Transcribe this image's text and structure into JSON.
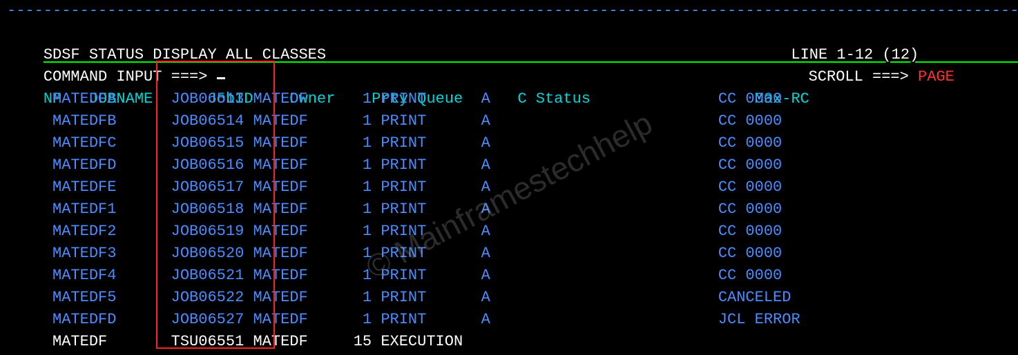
{
  "divider_line": "-----------------------------------------------------------------------------------------------------------------------",
  "header": {
    "title_left": "SDSF STATUS DISPLAY ALL CLASSES",
    "title_right": "LINE 1-12 (12)",
    "cmd_label": "COMMAND INPUT ===>",
    "scroll_label": "SCROLL ===>",
    "scroll_value": "PAGE"
  },
  "columns": {
    "np": "NP",
    "jobname": "JOBNAME",
    "jobid": "JobID",
    "owner": "Owner",
    "prty": "Prty",
    "queue": "Queue",
    "c": "C",
    "status": "Status",
    "maxrc": "Max-RC"
  },
  "rows": [
    {
      "np": "",
      "jobname": "MATEDFA",
      "jobid": "JOB06513",
      "owner": "MATEDF",
      "prty": "1",
      "queue": "PRINT",
      "c": "A",
      "status": "",
      "maxrc": "CC 0000",
      "color": "blue"
    },
    {
      "np": "",
      "jobname": "MATEDFB",
      "jobid": "JOB06514",
      "owner": "MATEDF",
      "prty": "1",
      "queue": "PRINT",
      "c": "A",
      "status": "",
      "maxrc": "CC 0000",
      "color": "blue"
    },
    {
      "np": "",
      "jobname": "MATEDFC",
      "jobid": "JOB06515",
      "owner": "MATEDF",
      "prty": "1",
      "queue": "PRINT",
      "c": "A",
      "status": "",
      "maxrc": "CC 0000",
      "color": "blue"
    },
    {
      "np": "",
      "jobname": "MATEDFD",
      "jobid": "JOB06516",
      "owner": "MATEDF",
      "prty": "1",
      "queue": "PRINT",
      "c": "A",
      "status": "",
      "maxrc": "CC 0000",
      "color": "blue"
    },
    {
      "np": "",
      "jobname": "MATEDFE",
      "jobid": "JOB06517",
      "owner": "MATEDF",
      "prty": "1",
      "queue": "PRINT",
      "c": "A",
      "status": "",
      "maxrc": "CC 0000",
      "color": "blue"
    },
    {
      "np": "",
      "jobname": "MATEDF1",
      "jobid": "JOB06518",
      "owner": "MATEDF",
      "prty": "1",
      "queue": "PRINT",
      "c": "A",
      "status": "",
      "maxrc": "CC 0000",
      "color": "blue"
    },
    {
      "np": "",
      "jobname": "MATEDF2",
      "jobid": "JOB06519",
      "owner": "MATEDF",
      "prty": "1",
      "queue": "PRINT",
      "c": "A",
      "status": "",
      "maxrc": "CC 0000",
      "color": "blue"
    },
    {
      "np": "",
      "jobname": "MATEDF3",
      "jobid": "JOB06520",
      "owner": "MATEDF",
      "prty": "1",
      "queue": "PRINT",
      "c": "A",
      "status": "",
      "maxrc": "CC 0000",
      "color": "blue"
    },
    {
      "np": "",
      "jobname": "MATEDF4",
      "jobid": "JOB06521",
      "owner": "MATEDF",
      "prty": "1",
      "queue": "PRINT",
      "c": "A",
      "status": "",
      "maxrc": "CC 0000",
      "color": "blue"
    },
    {
      "np": "",
      "jobname": "MATEDF5",
      "jobid": "JOB06522",
      "owner": "MATEDF",
      "prty": "1",
      "queue": "PRINT",
      "c": "A",
      "status": "",
      "maxrc": "CANCELED",
      "color": "blue"
    },
    {
      "np": "",
      "jobname": "MATEDFD",
      "jobid": "JOB06527",
      "owner": "MATEDF",
      "prty": "1",
      "queue": "PRINT",
      "c": "A",
      "status": "",
      "maxrc": "JCL ERROR",
      "color": "blue"
    },
    {
      "np": "",
      "jobname": "MATEDF",
      "jobid": "TSU06551",
      "owner": "MATEDF",
      "prty": "15",
      "queue": "EXECUTION",
      "c": "",
      "status": "",
      "maxrc": "",
      "color": "white"
    }
  ],
  "watermark": "© Mainframestechhelp",
  "highlight": {
    "column": "JobID"
  }
}
